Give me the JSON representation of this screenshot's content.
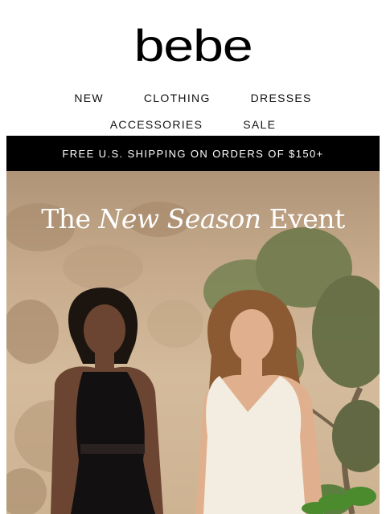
{
  "brand": {
    "logo_text": "bebe"
  },
  "nav": {
    "row1": [
      "NEW",
      "CLOTHING",
      "DRESSES"
    ],
    "row2": [
      "ACCESSORIES",
      "SALE"
    ]
  },
  "promo_bar": {
    "text": "FREE U.S. SHIPPING ON ORDERS OF $150+"
  },
  "hero": {
    "headline_part1": "The ",
    "headline_italic": "New Season",
    "headline_part2": " Event",
    "image_alt": "Two models in a black lace halter jumpsuit and a white ruffle-trim jumpsuit against a stone wall with an olive tree"
  },
  "colors": {
    "bar": "#000000",
    "text": "#111111",
    "background": "#ffffff"
  }
}
